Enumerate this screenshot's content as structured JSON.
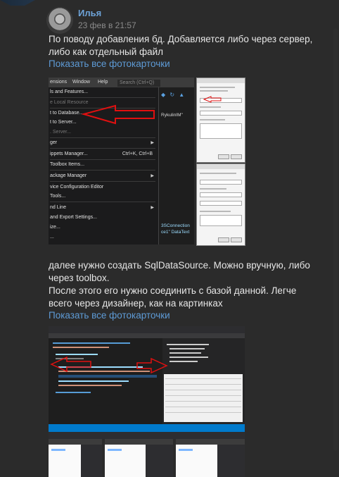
{
  "post": {
    "author": "Илья",
    "date": "23 фев в 21:57",
    "paragraph1": [
      "По поводу добавления бд. Добавляется либо через сервер,",
      "либо как отдельный файл"
    ],
    "link1": "Показать все фотокарточки",
    "paragraph2": [
      "далее нужно создать SqlDataSource. Можно вручную, либо",
      "через toolbox.",
      "После этого его нужно соединить с базой данной. Легче",
      "всего через дизайнер, как на картинках"
    ],
    "link2": "Показать все фотокарточки"
  },
  "screenshot_menu": {
    "menubar": [
      "ensions",
      "Window",
      "Help"
    ],
    "search_placeholder": "Search (Ctrl+Q)",
    "items": [
      {
        "label": "ls and Features...",
        "dim": false
      },
      {
        "label": "e Local Resource",
        "dim": true
      },
      {
        "label": "t to Database...",
        "dim": false
      },
      {
        "label": "t to Server...",
        "dim": false
      },
      {
        "label": ". Server...",
        "dim": true
      },
      {
        "label": "ger",
        "dim": false,
        "submenu": true
      },
      {
        "label": "ippets Manager...",
        "dim": false,
        "shortcut": "Ctrl+K, Ctrl+B"
      },
      {
        "label": "Toolbox Items...",
        "dim": false
      },
      {
        "label": "ackage Manager",
        "dim": false,
        "submenu": true
      },
      {
        "label": "vice Configuration Editor",
        "dim": false
      },
      {
        "label": "Tools...",
        "dim": false
      },
      {
        "label": "nd Line",
        "dim": false,
        "submenu": true
      },
      {
        "label": "and Export Settings...",
        "dim": false
      },
      {
        "label": "ize...",
        "dim": false
      },
      {
        "label": "...",
        "dim": false
      }
    ],
    "code_lines": [
      "RykulinIM\"",
      "3SConnection",
      "ce1\" DataText"
    ]
  },
  "colors": {
    "link": "#5e9bd6",
    "author": "#6ea3d8",
    "annotation_arrow": "#e01010",
    "vs_status": "#007acc"
  }
}
